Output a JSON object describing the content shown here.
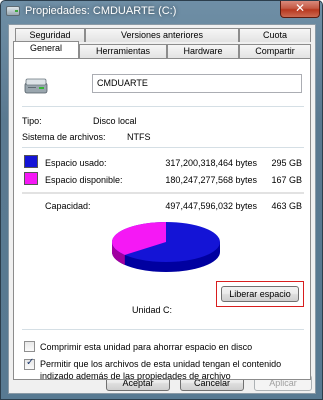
{
  "window": {
    "title": "Propiedades: CMDUARTE (C:)",
    "close_glyph": "✕",
    "titlebar_color": "#5a7990",
    "close_color": "#c45a45"
  },
  "tabs_row1": [
    {
      "label": "Seguridad"
    },
    {
      "label": "Versiones anteriores"
    },
    {
      "label": "Cuota"
    }
  ],
  "tabs_row2": [
    {
      "label": "General",
      "active": true
    },
    {
      "label": "Herramientas"
    },
    {
      "label": "Hardware"
    },
    {
      "label": "Compartir"
    }
  ],
  "general": {
    "drive_name": "CMDUARTE",
    "type_label": "Tipo:",
    "type_value": "Disco local",
    "fs_label": "Sistema de archivos:",
    "fs_value": "NTFS",
    "used": {
      "label": "Espacio usado:",
      "bytes": "317,200,318,464 bytes",
      "size": "295 GB",
      "color": "#1414d6"
    },
    "free": {
      "label": "Espacio disponible:",
      "bytes": "180,247,277,568 bytes",
      "size": "167 GB",
      "color": "#f518f5"
    },
    "capacity": {
      "label": "Capacidad:",
      "bytes": "497,447,596,032 bytes",
      "size": "463 GB"
    },
    "used_fraction": 0.638,
    "drive_letter": "Unidad C:",
    "cleanup_button": "Liberar espacio",
    "compress_label": "Comprimir esta unidad para ahorrar espacio en disco",
    "compress_checked": false,
    "index_label_line1": "Permitir que los archivos de esta unidad tengan el contenido",
    "index_label_line2": "indizado además de las propiedades de archivo",
    "index_checked": true,
    "check_glyph": "✓"
  },
  "footer": {
    "accept": "Aceptar",
    "cancel": "Cancelar",
    "apply": "Aplicar"
  }
}
